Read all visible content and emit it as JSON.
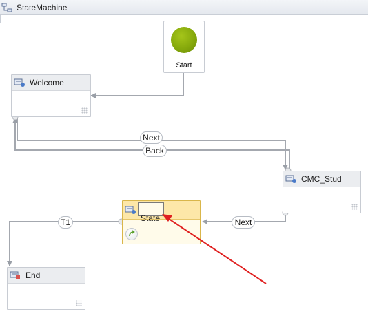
{
  "window": {
    "title": "StateMachine",
    "icon": "state-machine-icon"
  },
  "start": {
    "label": "Start",
    "color": "#8fb214"
  },
  "states": {
    "welcome": {
      "label": "Welcome",
      "icon": "state-icon"
    },
    "cmc_stud": {
      "label": "CMC_Stud",
      "icon": "state-icon"
    },
    "new_state": {
      "label": "State",
      "icon": "state-icon",
      "highlight_color": "#fde7a8"
    },
    "end": {
      "label": "End",
      "icon": "final-state-icon"
    }
  },
  "transitions": {
    "welcome_to_cmc": "Next",
    "cmc_to_welcome": "Back",
    "cmc_to_state": "Next",
    "state_to_end": "T1"
  },
  "annotation": {
    "arrow_color": "#e02020"
  }
}
